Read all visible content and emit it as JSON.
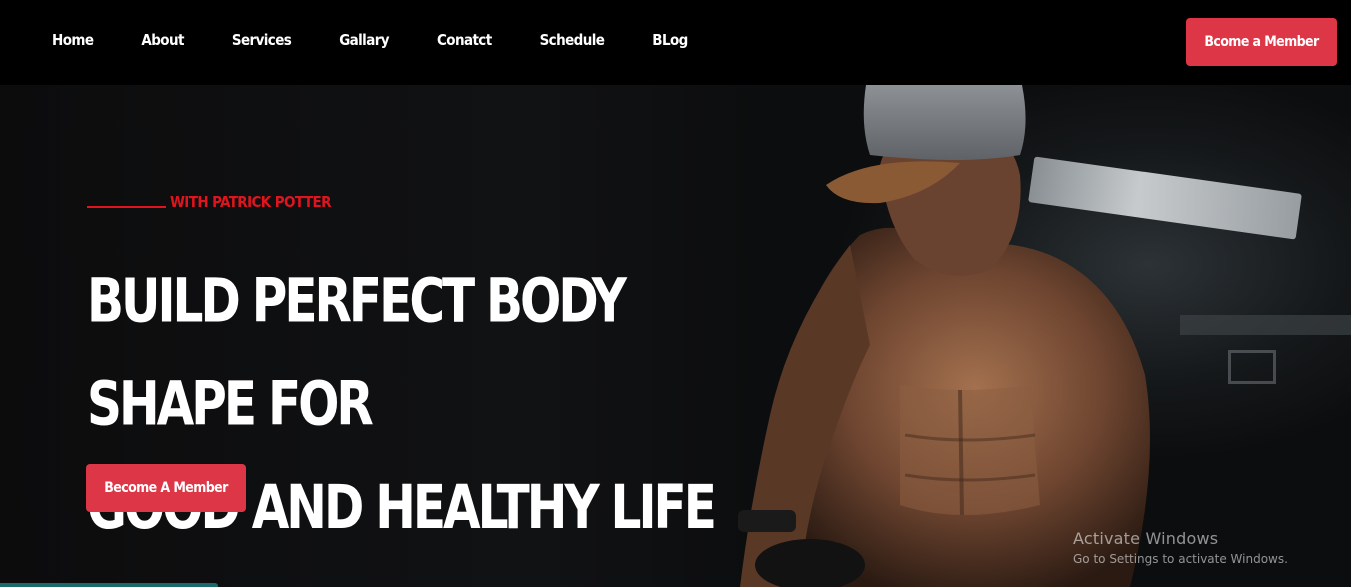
{
  "nav": {
    "links": [
      "Home",
      "About",
      "Services",
      "Gallary",
      "Conatct",
      "Schedule",
      "BLog"
    ],
    "cta_label": "Bcome a Member"
  },
  "hero": {
    "tagline": "WITH PATRICK POTTER",
    "title_line1": "BUILD PERFECT BODY SHAPE FOR",
    "title_line2": "GOOD AND HEALTHY LIFE",
    "cta_label": "Become A Member"
  },
  "watermark": {
    "title": "Activate Windows",
    "subtitle": "Go to Settings to activate Windows."
  },
  "colors": {
    "accent": "#dd3646",
    "tagline": "#e0141e",
    "nav_background": "#000000"
  }
}
